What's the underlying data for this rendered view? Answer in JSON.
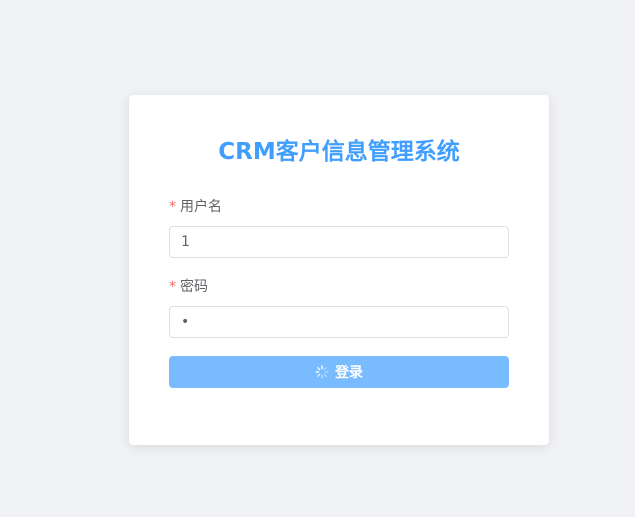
{
  "colors": {
    "page_background": "#f0f2f5",
    "title": "#409eff",
    "required_star": "#f56c6c",
    "button_loading": "#79bbff"
  },
  "login": {
    "title": "CRM客户信息管理系统",
    "username": {
      "required_mark": "*",
      "label": "用户名",
      "value": "1"
    },
    "password": {
      "required_mark": "*",
      "label": "密码",
      "value": "1"
    },
    "submit": {
      "label": "登录",
      "icon": "loading-spinner-icon",
      "loading": true
    }
  }
}
